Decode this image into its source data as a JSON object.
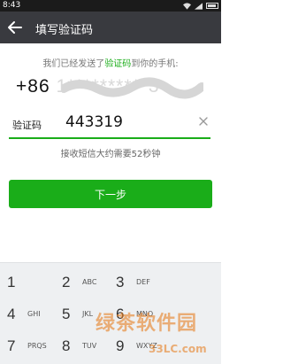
{
  "status_bar": {
    "time": "8:43"
  },
  "header": {
    "title": "填写验证码"
  },
  "prompt": {
    "prefix": "我们已经发送了",
    "link": "验证码",
    "suffix": "到你的手机:"
  },
  "phone": {
    "code": "+86",
    "masked_number": "1**********3"
  },
  "verification": {
    "label": "验证码",
    "value": "443319"
  },
  "countdown_text": "接收短信大约需要52秒钟",
  "next_button": "下一步",
  "keyboard": {
    "rows": [
      [
        {
          "digit": "1",
          "letters": ""
        },
        {
          "digit": "2",
          "letters": "ABC"
        },
        {
          "digit": "3",
          "letters": "DEF"
        }
      ],
      [
        {
          "digit": "4",
          "letters": "GHI"
        },
        {
          "digit": "5",
          "letters": "JKL"
        },
        {
          "digit": "6",
          "letters": "MNO"
        }
      ],
      [
        {
          "digit": "7",
          "letters": "PRQS"
        },
        {
          "digit": "8",
          "letters": "TUV"
        },
        {
          "digit": "9",
          "letters": "WXYZ"
        }
      ]
    ]
  },
  "watermark": {
    "main": "绿茶软件园",
    "sub": "33LC.com"
  },
  "colors": {
    "accent": "#1aad19",
    "title_bar": "#393a3f"
  }
}
